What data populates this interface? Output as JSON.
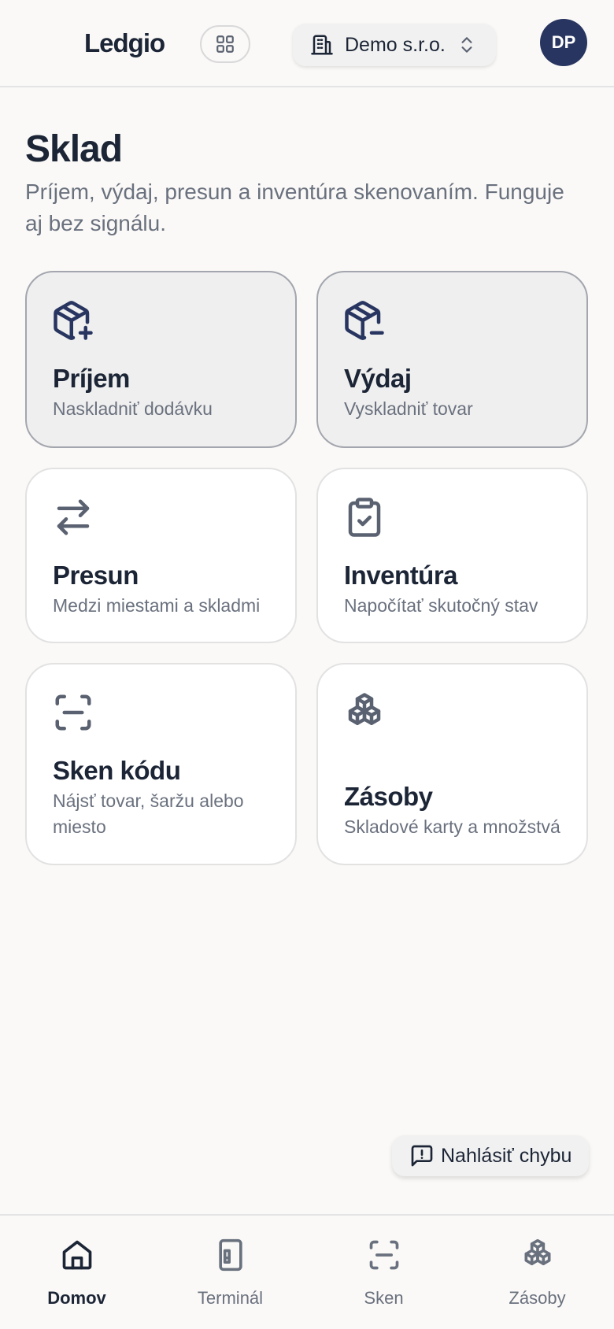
{
  "header": {
    "logo": "Ledgio",
    "company": "Demo s.r.o.",
    "avatar_initials": "DP"
  },
  "page": {
    "title": "Sklad",
    "subtitle": "Príjem, výdaj, presun a inventúra skenovaním. Funguje aj bez signálu."
  },
  "cards": [
    {
      "title": "Príjem",
      "subtitle": "Naskladniť dodávku",
      "icon": "package-plus-icon"
    },
    {
      "title": "Výdaj",
      "subtitle": "Vyskladniť tovar",
      "icon": "package-minus-icon"
    },
    {
      "title": "Presun",
      "subtitle": "Medzi miestami a skladmi",
      "icon": "arrows-left-right-icon"
    },
    {
      "title": "Inventúra",
      "subtitle": "Napočítať skutočný stav",
      "icon": "clipboard-check-icon"
    },
    {
      "title": "Sken kódu",
      "subtitle": "Nájsť tovar, šaržu alebo miesto",
      "icon": "scan-icon"
    },
    {
      "title": "Zásoby",
      "subtitle": "Skladové karty a množstvá",
      "icon": "boxes-icon"
    }
  ],
  "report_button": {
    "label": "Nahlásiť chybu"
  },
  "nav": [
    {
      "label": "Domov",
      "icon": "home-icon",
      "active": true
    },
    {
      "label": "Terminál",
      "icon": "terminal-device-icon",
      "active": false
    },
    {
      "label": "Sken",
      "icon": "scan-icon",
      "active": false
    },
    {
      "label": "Zásoby",
      "icon": "boxes-icon",
      "active": false
    }
  ],
  "colors": {
    "primary": "#283560",
    "text": "#1c2536",
    "muted": "#6a717e",
    "background": "#faf9f7"
  }
}
